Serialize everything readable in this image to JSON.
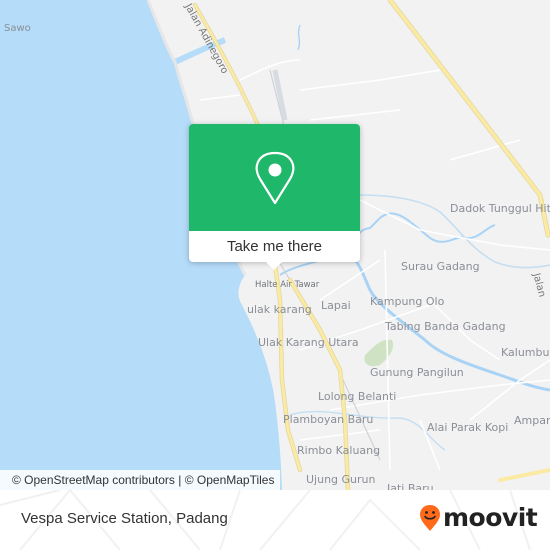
{
  "map": {
    "colors": {
      "water": "#b5dcf9",
      "land": "#f2f2f3",
      "major_road": "#fbeaa4",
      "river": "#a9d3f5",
      "park": "#cfe3c4",
      "popup_green": "#1fb769"
    },
    "labels": {
      "sawo": "Sawo",
      "jalan_adinegoro": "Jalan Adinegoro",
      "dadok_tunggul_hitam": "Dadok Tunggul Hitam",
      "surau_gadang": "Surau Gadang",
      "jalan_partial": "Jalan",
      "halte_air_tawar": "Halte Air Tawar",
      "lapai": "Lapai",
      "kampung_olo": "Kampung Olo",
      "ulak_karang": "ulak karang",
      "tabing_banda_gadang": "Tabing Banda Gadang",
      "ulak_karang_utara": "Ulak Karang Utara",
      "kalumbuk": "Kalumbuk",
      "gunung_pangilun": "Gunung Pangilun",
      "lolong_belanti": "Lolong Belanti",
      "plamboyan_baru": "Plamboyan Baru",
      "alai_parak_kopi": "Alai Parak Kopi",
      "ampang": "Ampang",
      "rimbo_kaluang": "Rimbo Kaluang",
      "ujung_gurun": "Ujung Gurun",
      "jati_baru": "Jati Baru"
    },
    "popup": {
      "icon": "map-pin-icon",
      "cta_label": "Take me there"
    },
    "attribution": "© OpenStreetMap contributors | © OpenMapTiles"
  },
  "footer": {
    "place_name": "Vespa Service Station, Padang",
    "brand": {
      "icon": "moovit-smiley-pin-icon",
      "name": "moovit",
      "color": "#ff6a1a"
    }
  }
}
